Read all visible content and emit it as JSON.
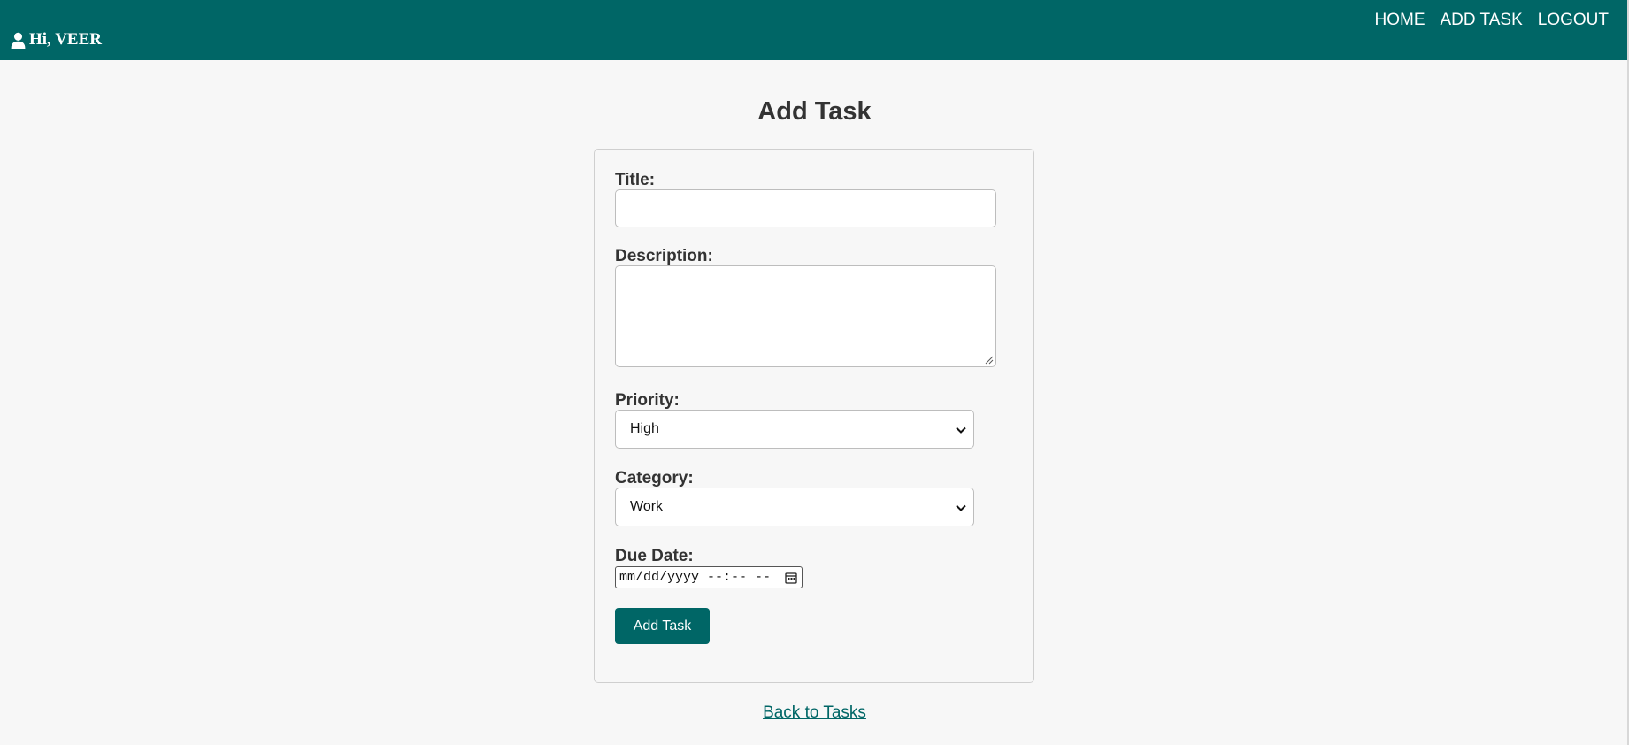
{
  "header": {
    "greeting": "Hi, VEER",
    "nav": [
      "HOME",
      "ADD TASK",
      "LOGOUT"
    ],
    "background_color": "#006666"
  },
  "page": {
    "title": "Add Task"
  },
  "form": {
    "title_label": "Title:",
    "title_value": "",
    "description_label": "Description:",
    "description_value": "",
    "priority_label": "Priority:",
    "priority_value": "High",
    "category_label": "Category:",
    "category_value": "Work",
    "due_date_label": "Due Date:",
    "due_date_placeholder": "mm/dd/yyyy --:-- --",
    "submit_label": "Add Task",
    "accent_color": "#006666"
  },
  "footer": {
    "back_link": "Back to Tasks"
  }
}
